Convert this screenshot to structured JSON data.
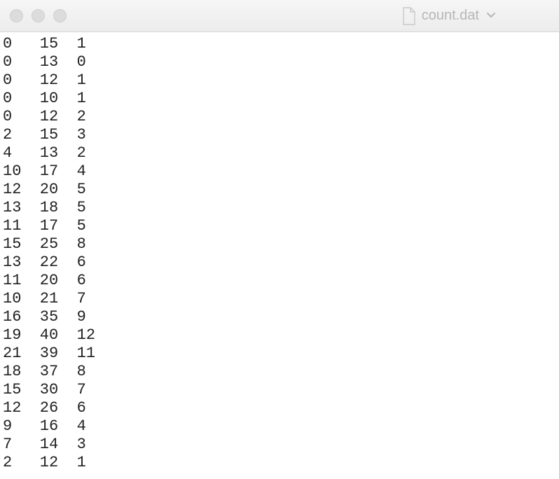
{
  "window": {
    "filename": "count.dat"
  },
  "rows": [
    [
      0,
      15,
      1
    ],
    [
      0,
      13,
      0
    ],
    [
      0,
      12,
      1
    ],
    [
      0,
      10,
      1
    ],
    [
      0,
      12,
      2
    ],
    [
      2,
      15,
      3
    ],
    [
      4,
      13,
      2
    ],
    [
      10,
      17,
      4
    ],
    [
      12,
      20,
      5
    ],
    [
      13,
      18,
      5
    ],
    [
      11,
      17,
      5
    ],
    [
      15,
      25,
      8
    ],
    [
      13,
      22,
      6
    ],
    [
      11,
      20,
      6
    ],
    [
      10,
      21,
      7
    ],
    [
      16,
      35,
      9
    ],
    [
      19,
      40,
      12
    ],
    [
      21,
      39,
      11
    ],
    [
      18,
      37,
      8
    ],
    [
      15,
      30,
      7
    ],
    [
      12,
      26,
      6
    ],
    [
      9,
      16,
      4
    ],
    [
      7,
      14,
      3
    ],
    [
      2,
      12,
      1
    ]
  ]
}
